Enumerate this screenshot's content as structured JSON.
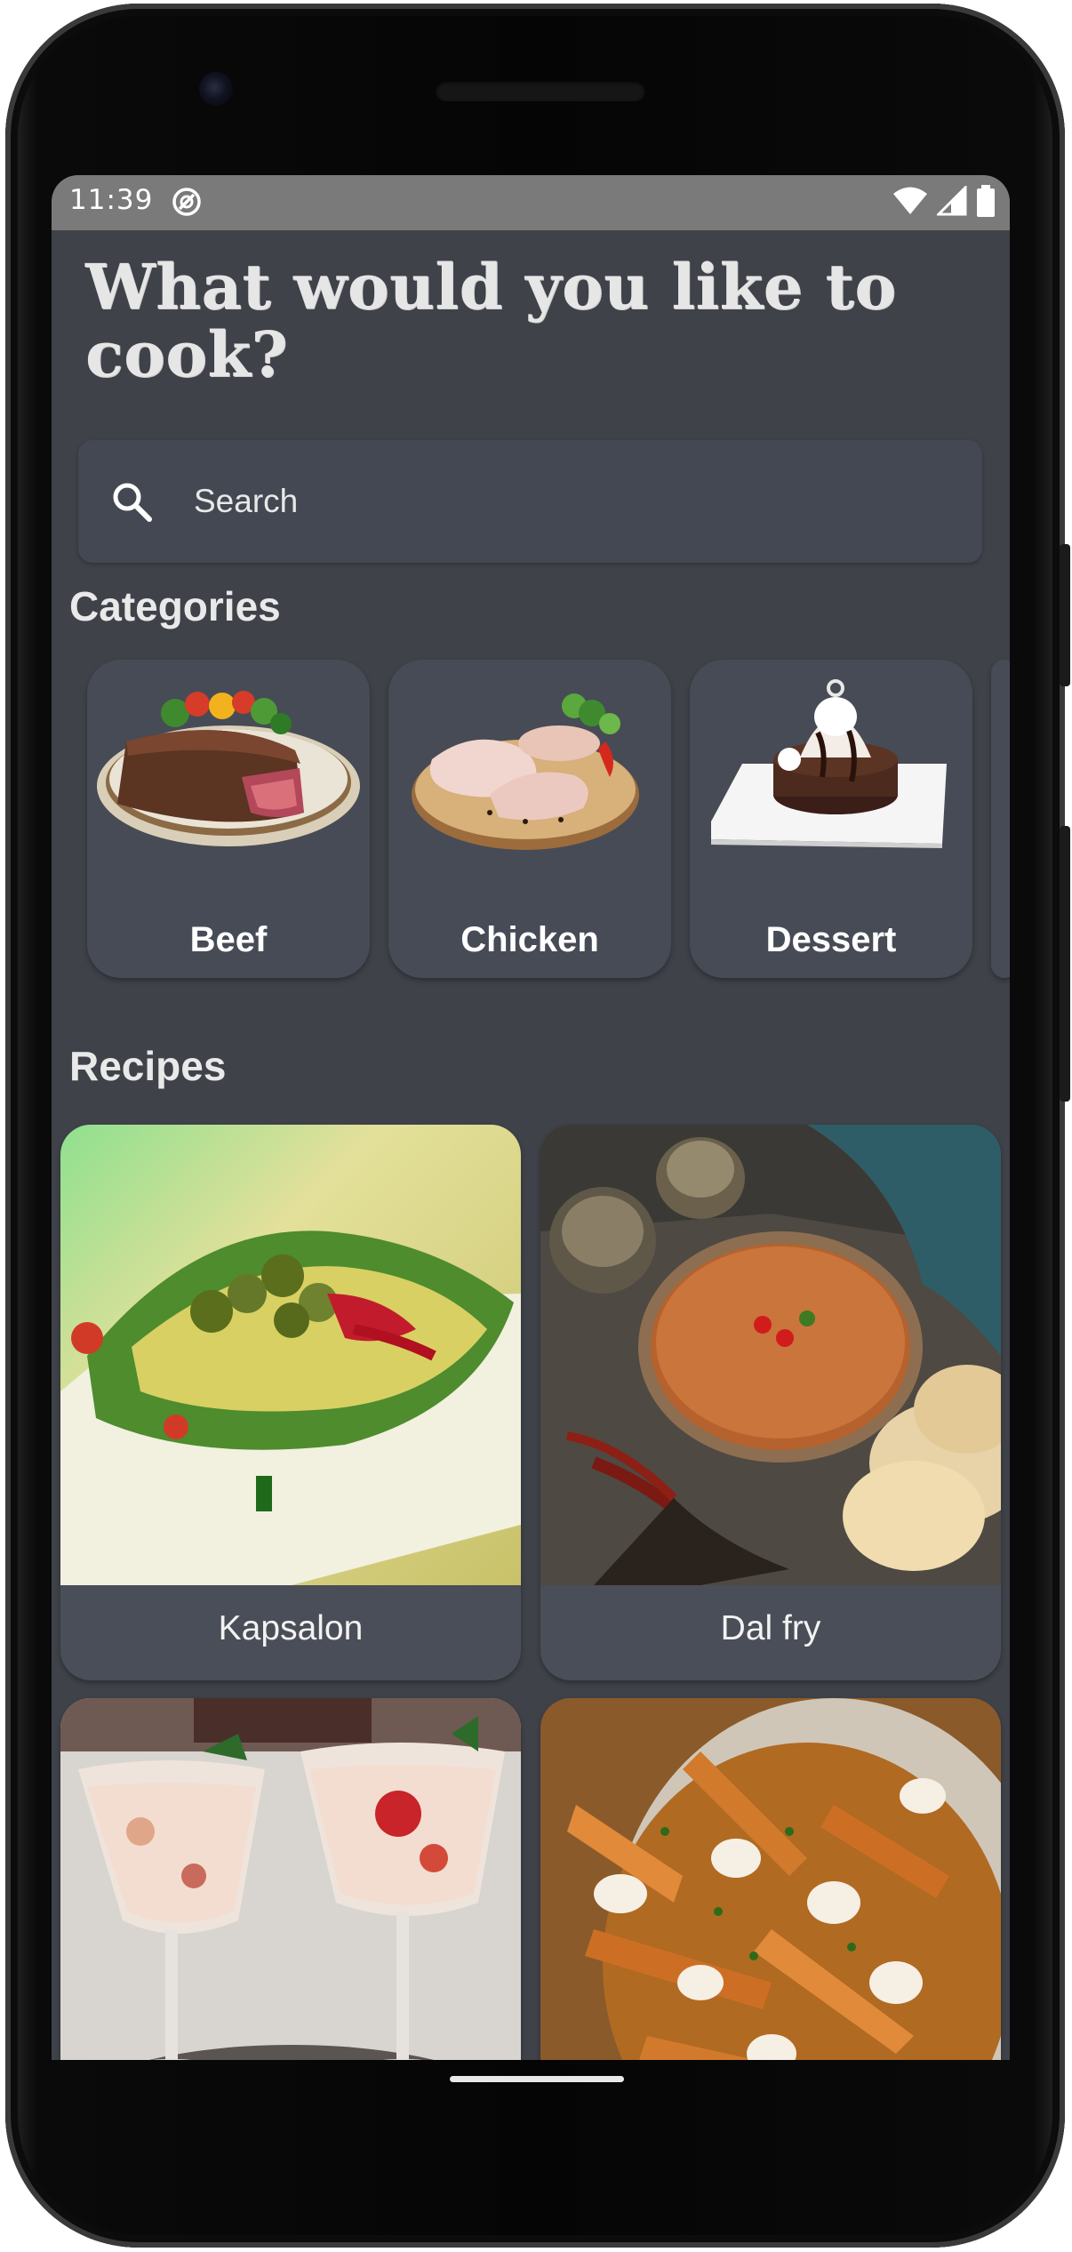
{
  "status_bar": {
    "time": "11:39",
    "notification_icon": "do-not-disturb-icon",
    "icons": [
      "wifi-icon",
      "signal-icon",
      "battery-icon"
    ]
  },
  "header": {
    "title": "What would you like to cook?"
  },
  "search": {
    "placeholder": "Search",
    "value": "",
    "icon": "search-icon"
  },
  "categories": {
    "title": "Categories",
    "items": [
      {
        "label": "Beef",
        "icon": "steak-image"
      },
      {
        "label": "Chicken",
        "icon": "chicken-image"
      },
      {
        "label": "Dessert",
        "icon": "dessert-image"
      }
    ]
  },
  "recipes": {
    "title": "Recipes",
    "items": [
      {
        "label": "Kapsalon",
        "image": "kapsalon-image"
      },
      {
        "label": "Dal fry",
        "image": "dal-fry-image"
      },
      {
        "label": "",
        "image": "dessert-glasses-image"
      },
      {
        "label": "",
        "image": "poutine-image"
      }
    ]
  },
  "colors": {
    "background": "#3f4249",
    "card": "#474b55",
    "status_bar": "#7a7a7a",
    "text": "#ffffff"
  }
}
